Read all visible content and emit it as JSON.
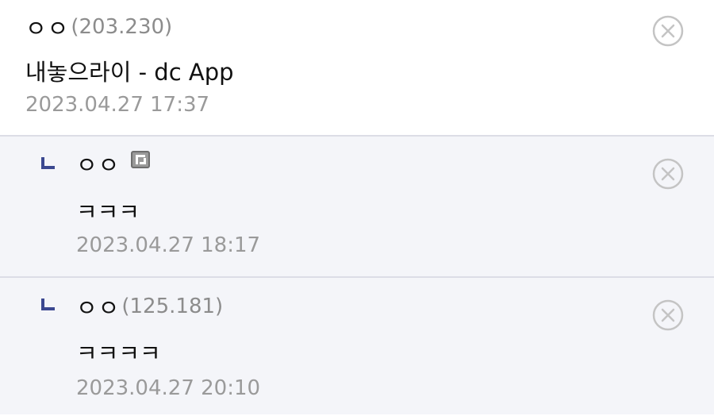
{
  "comments": [
    {
      "nick": "ㅇㅇ",
      "ip": "(203.230)",
      "body": "내놓으라이 - dc App",
      "date": "2023.04.27 17:37",
      "delete_icon": "circle-x-icon"
    }
  ],
  "replies": [
    {
      "nick": "ㅇㅇ",
      "badge_icon": "fixed-nick-icon",
      "body": "ㅋㅋㅋ",
      "date": "2023.04.27 18:17",
      "delete_icon": "circle-x-icon"
    },
    {
      "nick": "ㅇㅇ",
      "ip": "(125.181)",
      "body": "ㅋㅋㅋㅋ",
      "date": "2023.04.27 20:10",
      "delete_icon": "circle-x-icon"
    }
  ],
  "colors": {
    "reply_background": "#f4f5f9",
    "divider": "#dcdde6",
    "reply_arrow": "#3b4890",
    "meta_text": "#9a9a9a"
  }
}
